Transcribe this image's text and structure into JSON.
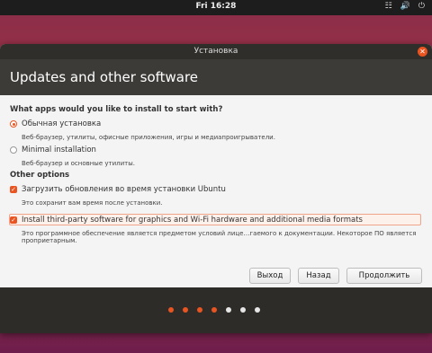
{
  "topbar": {
    "clock": "Fri 16:28"
  },
  "window": {
    "title": "Установка",
    "header_title": "Updates and other software"
  },
  "question": "What apps would you like to install to start with?",
  "install_options": [
    {
      "label": "Обычная установка",
      "description": "Веб-браузер, утилиты, офисные приложения, игры и медиапроигрыватели.",
      "selected": true
    },
    {
      "label": "Minimal installation",
      "description": "Веб-браузер и основные утилиты.",
      "selected": false
    }
  ],
  "other_options_heading": "Other options",
  "other_options": [
    {
      "label": "Загрузить обновления во время установки Ubuntu",
      "description": "Это сохранит вам время после установки.",
      "checked": true
    },
    {
      "label": "Install third-party software for graphics and Wi-Fi hardware and additional media formats",
      "description": "Это программное обеспечение является предметом условий лице…гаемого к документации. Некоторое ПО является проприетарным.",
      "checked": true
    }
  ],
  "buttons": {
    "quit": "Выход",
    "back": "Назад",
    "continue": "Продолжить"
  },
  "progress": {
    "completed_steps": 4,
    "total_steps": 7
  },
  "colors": {
    "accent": "#e95420",
    "header": "#3c3b37",
    "titlebar": "#2f2e2b"
  }
}
